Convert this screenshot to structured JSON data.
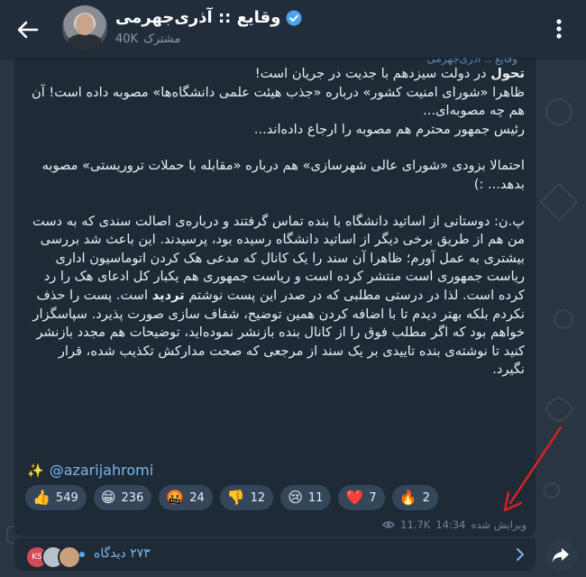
{
  "header": {
    "title": "وقایع :: آذری‌جهرمی",
    "subscriber_count": "40K",
    "subscriber_label": "مشترک"
  },
  "message": {
    "forward_from": "وقایع :: آذری‌جهرمی",
    "bold_start": "تحول",
    "line1_rest": " در دولت سیزدهم با جدیت در جریان است!",
    "line2": "ظاهرا «شورای امنیت کشور» درباره «جذب هیئت علمی دانشگاه‌ها» مصوبه داده است! آن هم چه مصوبه‌ای...",
    "line3": "رئیس جمهور محترم هم مصوبه را ارجاع داده‌اند...",
    "line4": "احتمالا بزودی «شورای عالی شهرسازی» هم درباره «مقابله با حملات تروریستی» مصوبه بدهد... :)",
    "ps_before_bold": "پ.ن: دوستانی از اساتید دانشگاه با بنده تماس گرفتند و درباره‌ی اصالت سندی که به دست من هم از طریق برخی دیگر از اساتید دانشگاه رسیده بود، پرسیدند. این باعث شد بررسی بیشتری به عمل آورم؛ ظاهرا آن سند را یک کانال که مدعی هک کردن اتوماسیون اداری ریاست جمهوری است منتشر کرده است و ریاست جمهوری هم یکبار کل ادعای هک را رد کرده است. لذا در درستی مطلبی که در صدر این پست نوشتم ",
    "ps_bold": "تردید",
    "ps_after_bold": " است. پست را حذف نکردم بلکه بهتر دیدم تا با اضافه کردن همین توضیح، شفاف سازی صورت پذیرد. سپاسگزار خواهم بود که اگر مطلب فوق را از کانال بنده بازنشر نموده‌اید، توضیحات هم مجدد بازنشر کنید تا نوشته‌ی بنده تاییدی بر یک سند از مرجعی که صحت مدارکش تکذیب شده، قرار نگیرد.",
    "mention": "@azarijahromi",
    "sparkle": "✨"
  },
  "reactions": [
    {
      "emoji": "👍",
      "count": "549",
      "icon": "thumbs-up-icon"
    },
    {
      "emoji": "😁",
      "count": "236",
      "icon": "grin-icon"
    },
    {
      "emoji": "🤬",
      "count": "24",
      "icon": "swearing-face-icon"
    },
    {
      "emoji": "👎",
      "count": "12",
      "icon": "thumbs-down-icon"
    },
    {
      "emoji": "😢",
      "count": "11",
      "icon": "crying-face-icon"
    },
    {
      "emoji": "❤️",
      "count": "7",
      "icon": "heart-icon"
    },
    {
      "emoji": "🔥",
      "count": "2",
      "icon": "fire-icon"
    }
  ],
  "meta": {
    "views": "11.7K",
    "time": "14:34",
    "edited": "ویرایش شده"
  },
  "comments": {
    "avatar1_initials": "KS",
    "views_label": "۲۷۳ دیدگاه"
  },
  "colors": {
    "background": "#2a3542",
    "bubble": "#1f2a37",
    "link": "#7bb7ec",
    "annotation_arrow": "#e02020"
  }
}
